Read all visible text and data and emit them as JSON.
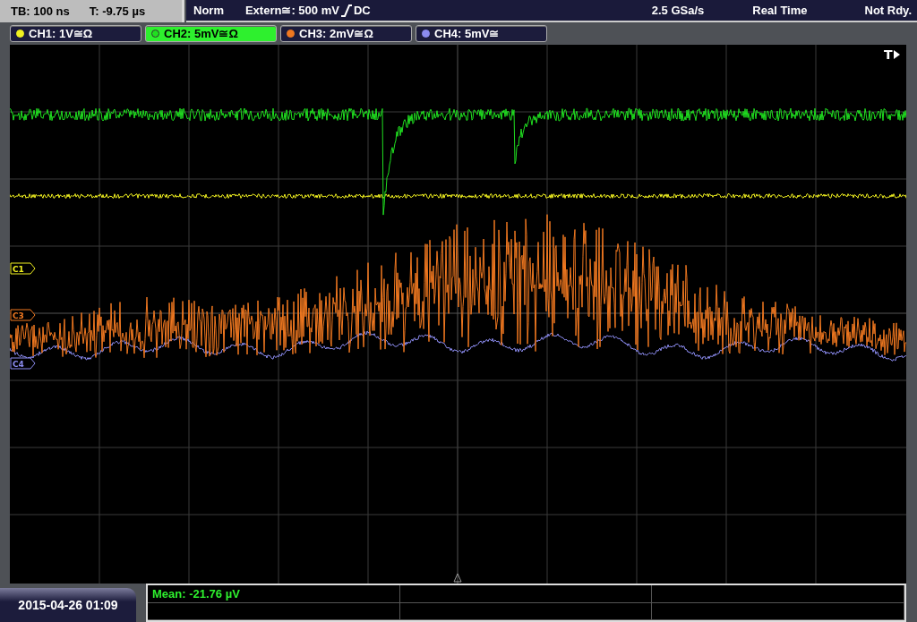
{
  "status_bar": {
    "timebase": "TB: 100 ns",
    "trigger_time": "T: -9.75 µs",
    "mode": "Norm",
    "trigger_source": "Extern≅: 500 mV",
    "trigger_coupling": "DC",
    "sample_rate": "2.5 GSa/s",
    "acquisition": "Real Time",
    "state": "Not Rdy."
  },
  "channels": [
    {
      "label": "CH1: 1V≅Ω",
      "selected": false,
      "color": "#f0f020",
      "marker": "C1"
    },
    {
      "label": "CH2: 5mV≅Ω",
      "selected": true,
      "color": "#20e020"
    },
    {
      "label": "CH3: 2mV≅Ω",
      "selected": false,
      "color": "#f07820",
      "marker": "C3"
    },
    {
      "label": "CH4: 5mV≅",
      "selected": false,
      "color": "#8c8cf0",
      "marker": "C4"
    }
  ],
  "trigger_marker": "T",
  "date": "2015-04-26 01:09",
  "measurements": [
    "Mean: -21.76 µV"
  ]
}
